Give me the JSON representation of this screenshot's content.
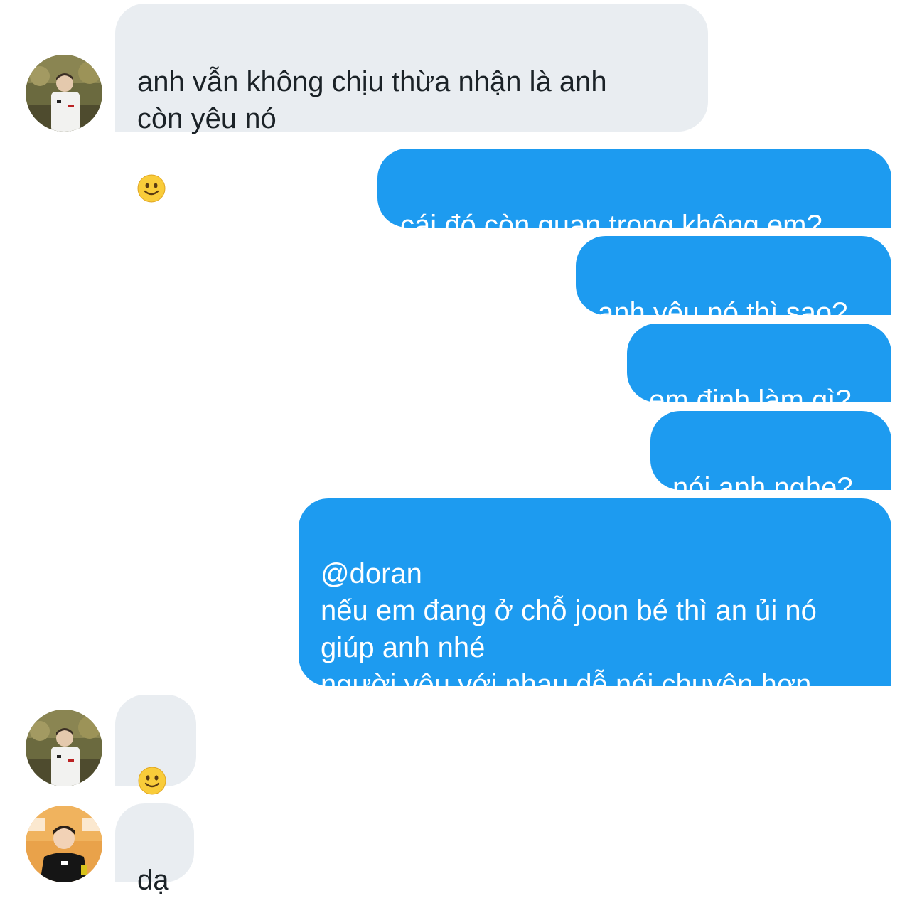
{
  "conversation": {
    "messages": [
      {
        "sender": "other",
        "text": "anh vẫn không chịu thừa nhận là anh\ncòn yêu nó",
        "emoji": "slightly-smiling-face"
      },
      {
        "sender": "me",
        "text": "cái đó còn quan trọng không em?"
      },
      {
        "sender": "me",
        "text": "anh yêu nó thì sao?"
      },
      {
        "sender": "me",
        "text": "em định làm gì?"
      },
      {
        "sender": "me",
        "text": "nói anh nghe?"
      },
      {
        "sender": "me",
        "text": "@doran\nnếu em đang ở chỗ joon bé thì an ủi nó\ngiúp anh nhé\nngười yêu với nhau dễ nói chuyện hơn"
      },
      {
        "sender": "other",
        "text": "",
        "emoji": "slightly-smiling-face"
      },
      {
        "sender": "other2",
        "text": "dạ"
      }
    ]
  },
  "colors": {
    "outgoing_bubble": "#1d9bf0",
    "incoming_bubble": "#e9edf1",
    "incoming_text": "#1b2227",
    "outgoing_text": "#ffffff"
  }
}
